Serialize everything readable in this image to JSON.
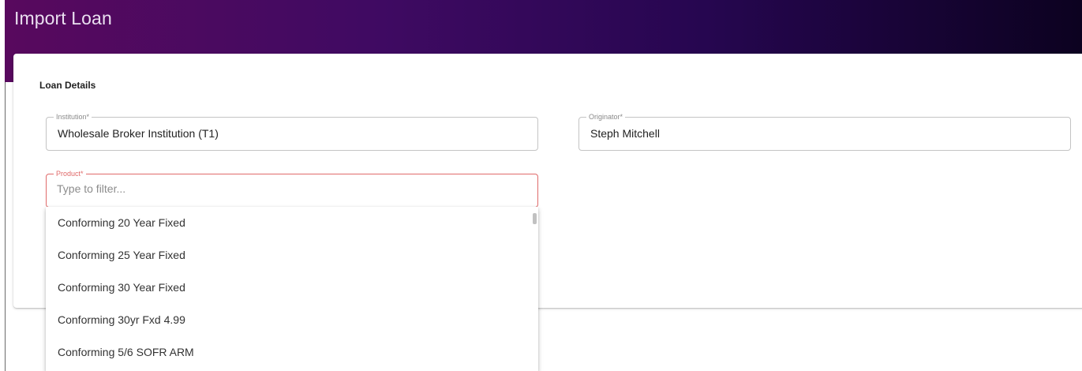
{
  "page": {
    "title": "Import Loan"
  },
  "loan_details": {
    "heading": "Loan Details",
    "institution": {
      "label": "Institution*",
      "value": "Wholesale Broker  Institution (T1)"
    },
    "originator": {
      "label": "Originator*",
      "value": "Steph Mitchell"
    },
    "product": {
      "label": "Product*",
      "placeholder": "Type to filter...",
      "value": ""
    }
  },
  "product_dropdown": {
    "options": [
      "Conforming 20 Year Fixed",
      "Conforming 25 Year Fixed",
      "Conforming 30 Year Fixed",
      "Conforming 30yr Fxd 4.99",
      "Conforming 5/6 SOFR ARM"
    ]
  },
  "colors": {
    "header_gradient_start": "#58095e",
    "header_gradient_end": "#0c0220",
    "active_field_border": "#e06a6a"
  }
}
